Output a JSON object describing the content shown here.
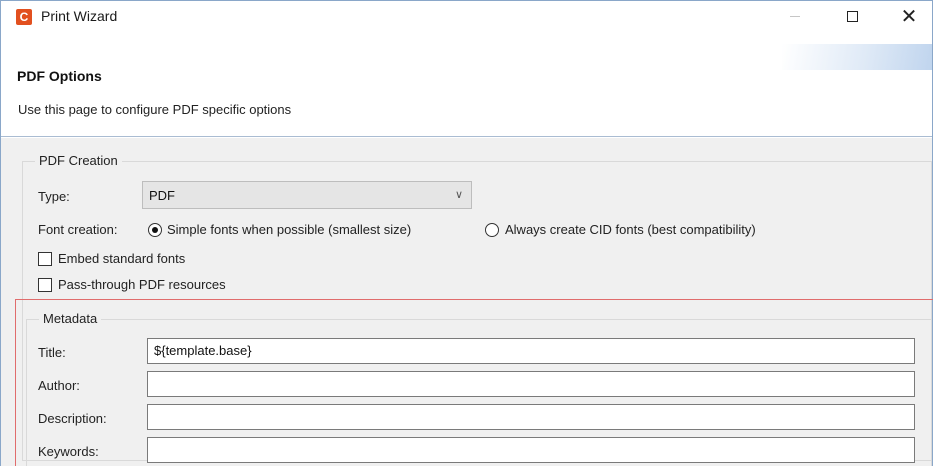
{
  "window": {
    "title": "Print Wizard",
    "icon": "app-c-icon",
    "icon_glyph": "C",
    "accent": "#e2501f"
  },
  "header": {
    "title": "PDF Options",
    "description": "Use this page to configure PDF specific options"
  },
  "pdf_creation": {
    "legend": "PDF Creation",
    "type_label": "Type:",
    "type_value": "PDF",
    "font_label": "Font creation:",
    "font_options": [
      {
        "label": "Simple fonts when possible (smallest size)",
        "selected": true
      },
      {
        "label": "Always create CID fonts (best compatibility)",
        "selected": false
      }
    ],
    "checkboxes": [
      {
        "label": "Embed standard fonts",
        "checked": false
      },
      {
        "label": "Pass-through PDF resources",
        "checked": false
      }
    ]
  },
  "metadata": {
    "legend": "Metadata",
    "fields": [
      {
        "label": "Title:",
        "value": "${template.base}"
      },
      {
        "label": "Author:",
        "value": ""
      },
      {
        "label": "Description:",
        "value": ""
      },
      {
        "label": "Keywords:",
        "value": ""
      }
    ]
  }
}
